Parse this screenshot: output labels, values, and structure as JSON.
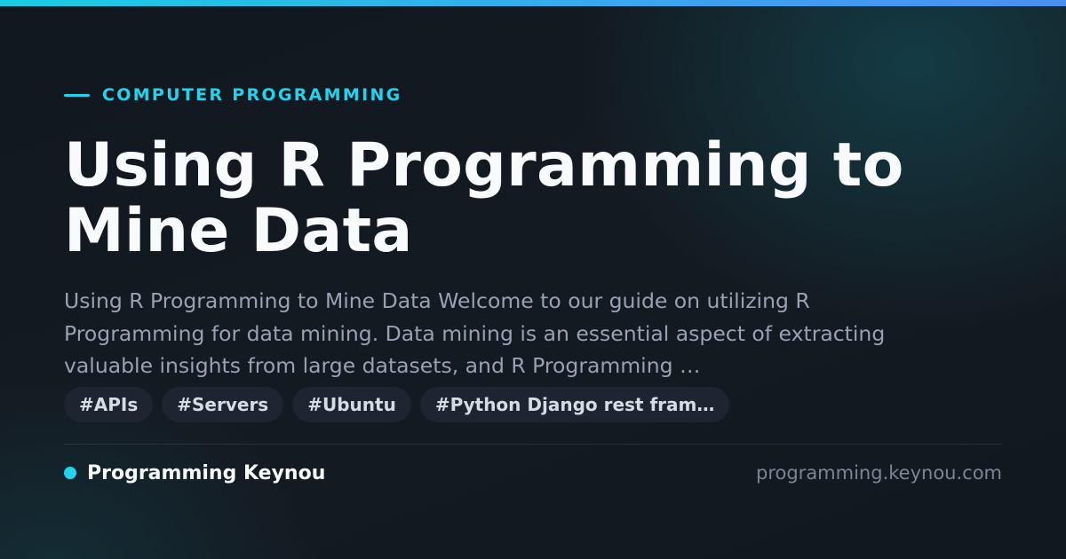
{
  "colors": {
    "accent": "#22d3ee",
    "background": "#121820",
    "title": "#f8fafc",
    "summary": "#98a2b3",
    "tag_background": "#1e2530",
    "url": "#7b8594"
  },
  "category": {
    "label": "COMPUTER PROGRAMMING"
  },
  "article": {
    "title": "Using R Programming to Mine Data",
    "summary": "Using R Programming to Mine Data Welcome to our guide on utilizing R Programming for data mining. Data mining is an essential aspect of extracting valuable insights from large datasets, and R Programming …"
  },
  "tags": [
    {
      "label": "#APIs"
    },
    {
      "label": "#Servers"
    },
    {
      "label": "#Ubuntu"
    },
    {
      "label": "#Python Django rest fram…"
    }
  ],
  "footer": {
    "brand_name": "Programming Keynou",
    "site_url": "programming.keynou.com"
  }
}
